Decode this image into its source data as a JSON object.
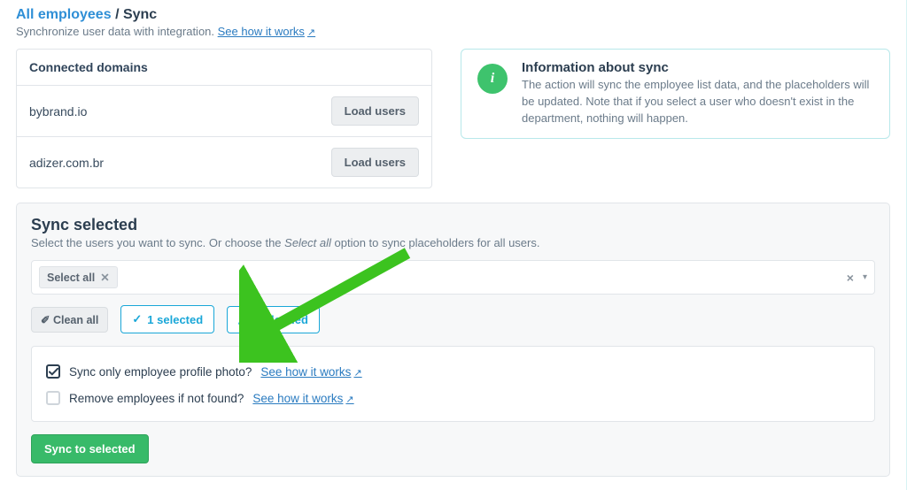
{
  "breadcrumb": {
    "root": "All employees",
    "current": "Sync"
  },
  "subtitle": {
    "text": "Synchronize user data with integration.",
    "link": "See how it works"
  },
  "domains": {
    "header": "Connected domains",
    "button_label": "Load users",
    "items": [
      "bybrand.io",
      "adizer.com.br"
    ]
  },
  "info": {
    "title": "Information about sync",
    "body": "The action will sync the employee list data, and the placeholders will be updated. Note that if you select a user who doesn't exist in the department, nothing will happen."
  },
  "sync": {
    "title": "Sync selected",
    "desc_before": "Select the users you want to sync. Or choose the ",
    "desc_em": "Select all",
    "desc_after": " option to sync placeholders for all users.",
    "token": "Select all",
    "clean_all": "Clean all",
    "selected_count": "1 selected",
    "loaded_count": "4 loaded",
    "opt1": "Sync only employee profile photo?",
    "opt2": "Remove employees if not found?",
    "how_link": "See how it works",
    "submit": "Sync to selected"
  }
}
